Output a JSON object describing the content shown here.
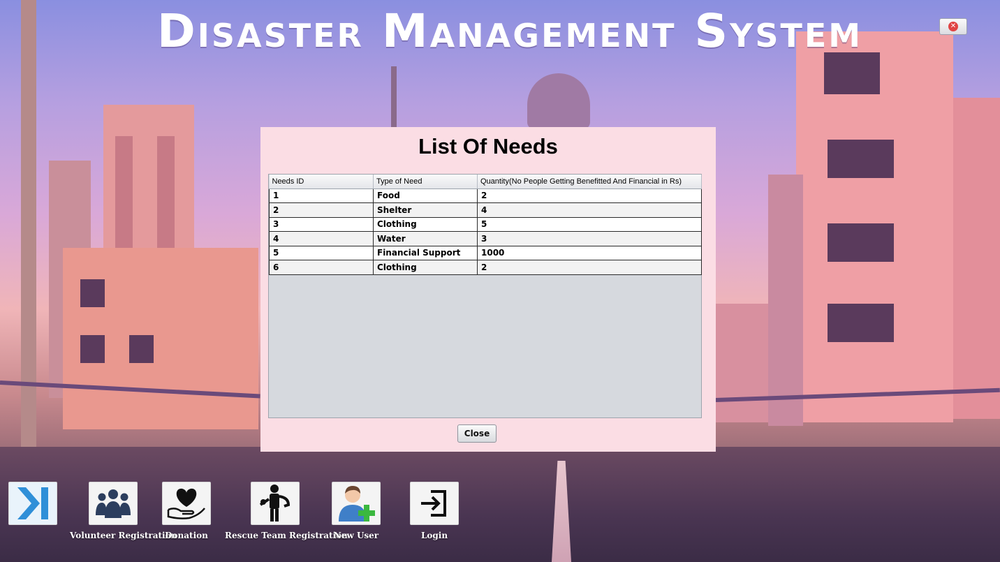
{
  "app": {
    "title": "Disaster Management System"
  },
  "dialog": {
    "title": "List Of Needs",
    "close_label": "Close",
    "columns": [
      "Needs ID",
      "Type of Need",
      "Quantity(No People Getting Benefitted And Financial in Rs)"
    ],
    "rows": [
      [
        "1",
        "Food",
        "2"
      ],
      [
        "2",
        "Shelter",
        "4"
      ],
      [
        "3",
        "Clothing",
        "5"
      ],
      [
        "4",
        "Water",
        "3"
      ],
      [
        "5",
        "Financial Support",
        "1000"
      ],
      [
        "6",
        "Clothing",
        "2"
      ]
    ]
  },
  "nav": {
    "items": [
      {
        "icon": "skip-forward-icon",
        "label": ""
      },
      {
        "icon": "group-icon",
        "label": "Volunteer Registration"
      },
      {
        "icon": "heart-hand-icon",
        "label": "Donation"
      },
      {
        "icon": "rescuer-icon",
        "label": "Rescue Team Registration"
      },
      {
        "icon": "add-user-icon",
        "label": "New User"
      },
      {
        "icon": "login-icon",
        "label": "Login"
      }
    ]
  },
  "colors": {
    "dialog_bg": "#fbdde4",
    "accent_blue": "#2f8fd8",
    "close_red": "#e04444"
  }
}
